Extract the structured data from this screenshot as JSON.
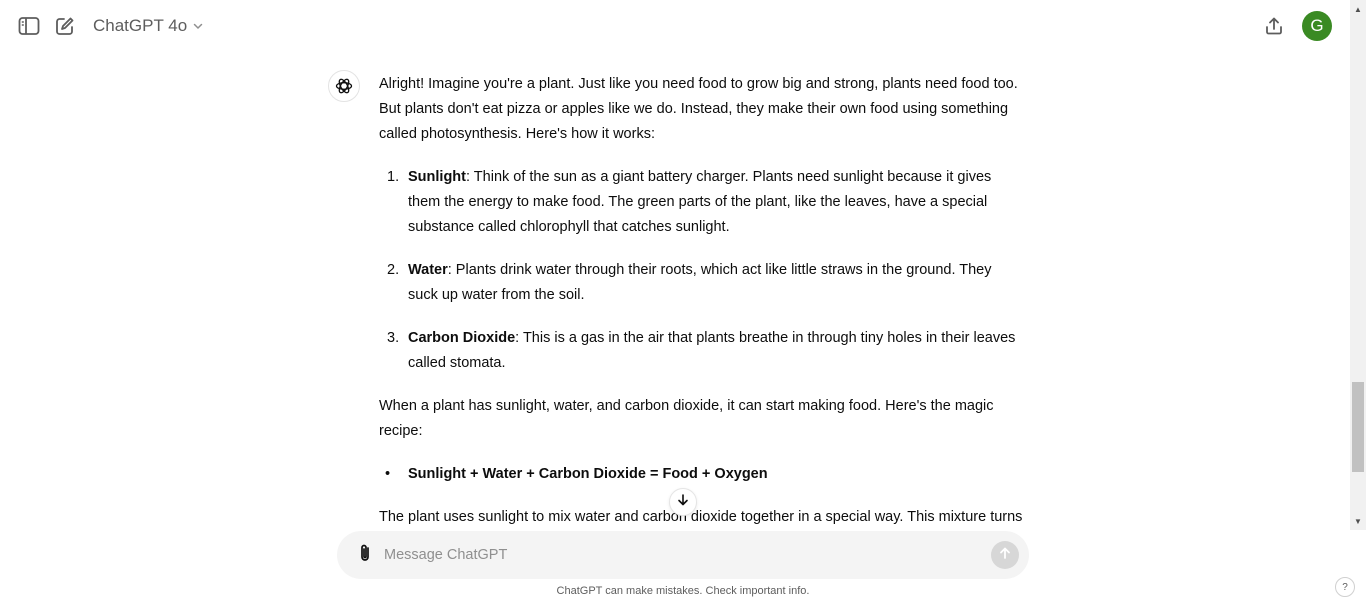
{
  "header": {
    "model_name": "ChatGPT 4o",
    "avatar_letter": "G",
    "avatar_color": "#3a8a23"
  },
  "message": {
    "intro": "Alright! Imagine you're a plant. Just like you need food to grow big and strong, plants need food too. But plants don't eat pizza or apples like we do. Instead, they make their own food using something called photosynthesis. Here's how it works:",
    "list": [
      {
        "num": "1.",
        "title": "Sunlight",
        "text": ": Think of the sun as a giant battery charger. Plants need sunlight because it gives them the energy to make food. The green parts of the plant, like the leaves, have a special substance called chlorophyll that catches sunlight."
      },
      {
        "num": "2.",
        "title": "Water",
        "text": ": Plants drink water through their roots, which act like little straws in the ground. They suck up water from the soil."
      },
      {
        "num": "3.",
        "title": "Carbon Dioxide",
        "text": ": This is a gas in the air that plants breathe in through tiny holes in their leaves called stomata."
      }
    ],
    "recipe_intro": "When a plant has sunlight, water, and carbon dioxide, it can start making food. Here's the magic recipe:",
    "bullet_marker": "•",
    "recipe": "Sunlight + Water + Carbon Dioxide = Food + Oxygen",
    "outro": "The plant uses sunlight to mix water and carbon dioxide together in a special way. This mixture turns"
  },
  "composer": {
    "placeholder": "Message ChatGPT"
  },
  "footer": {
    "disclaimer": "ChatGPT can make mistakes. Check important info.",
    "help_label": "?"
  },
  "icons": {
    "sidebar": "sidebar-toggle-icon",
    "new_chat": "new-chat-icon",
    "chevron": "chevron-down-icon",
    "share": "share-icon",
    "openai": "openai-logo-icon",
    "attach": "paperclip-icon",
    "send": "send-arrow-icon",
    "scroll_down": "arrow-down-icon"
  }
}
